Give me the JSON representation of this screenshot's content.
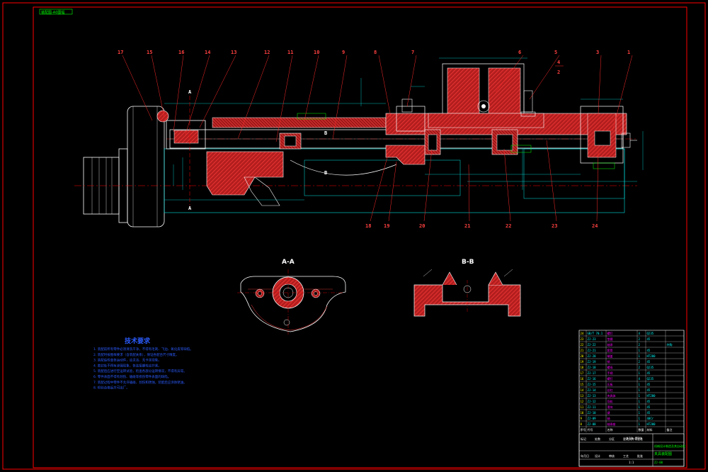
{
  "colors": {
    "background": "#000000",
    "frame": "#ff0000",
    "outline": "#ffffff",
    "hatch": "#ff3b3b",
    "hatch_fill": "#b21e1e",
    "dimension": "#00e5e5",
    "center": "#ff0000",
    "leader": "#ff2a2a",
    "callout": "#ff4040",
    "notes": "#2b5cff",
    "title_green": "#00ff00",
    "title_magenta": "#ff00ff",
    "title_yellow": "#ffff00",
    "title_cyan": "#00ffff"
  },
  "top_left_label": "装配图-A0图幅",
  "section_views": {
    "aa_label": "A-A",
    "bb_label": "B-B",
    "cut_marker_a": "A",
    "cut_marker_b": "B"
  },
  "callouts_top": [
    "17",
    "15",
    "16",
    "14",
    "13",
    "12",
    "11",
    "10",
    "9",
    "8",
    "7",
    "6",
    "5",
    "3",
    "1"
  ],
  "callouts_bottom": [
    "18",
    "19",
    "20",
    "21",
    "22",
    "23",
    "24"
  ],
  "callouts_side": [
    "4",
    "2"
  ],
  "tech_notes": {
    "title": "技术要求",
    "lines": [
      "1. 装配前所有零件必须清洗干净，不得有毛刺、飞边、氧化皮等缺陷。",
      "2. 装配时按图样要求（含装配关系），保证各配合尺寸精度。",
      "3. 装配后检查各运动件，应灵活、无卡滞现象。",
      "4. 密封处不得有渗漏现象，各连接螺栓应拧紧。",
      "5. 装配后应进行空运转试验，检查各部分运转情况，不得有异常。",
      "6. 零件表面不得有划伤、磕碰等损伤零件表面的缺陷。",
      "7. 装配过程中零件不允许磕碰、划伤和锈蚀，装配后应涂防锈油。",
      "8. 检验合格后方可出厂。"
    ]
  },
  "title_block": {
    "part_rows": [
      [
        "24",
        "GB/T 70.1",
        "螺钉",
        "4",
        "Q235",
        ""
      ],
      [
        "23",
        "ZJ-23",
        "垫圈",
        "2",
        "45",
        ""
      ],
      [
        "22",
        "ZJ-22",
        "轴承",
        "2",
        "",
        "外购"
      ],
      [
        "21",
        "ZJ-21",
        "套筒",
        "1",
        "45",
        ""
      ],
      [
        "20",
        "ZJ-20",
        "端盖",
        "1",
        "HT200",
        ""
      ],
      [
        "19",
        "ZJ-19",
        "销",
        "2",
        "45",
        ""
      ],
      [
        "18",
        "ZJ-18",
        "螺母",
        "2",
        "Q235",
        ""
      ],
      [
        "17",
        "ZJ-17",
        "手柄",
        "1",
        "45",
        ""
      ],
      [
        "16",
        "ZJ-16",
        "螺钉",
        "4",
        "Q235",
        ""
      ],
      [
        "15",
        "ZJ-15",
        "压板",
        "1",
        "45",
        ""
      ],
      [
        "14",
        "ZJ-14",
        "丝杠",
        "1",
        "45",
        ""
      ],
      [
        "13",
        "ZJ-13",
        "夹具体",
        "1",
        "HT200",
        ""
      ],
      [
        "12",
        "ZJ-12",
        "导轨",
        "1",
        "45",
        ""
      ],
      [
        "11",
        "ZJ-11",
        "滑块",
        "1",
        "45",
        ""
      ],
      [
        "10",
        "ZJ-10",
        "键",
        "1",
        "45",
        ""
      ],
      [
        "9",
        "ZJ-09",
        "轴",
        "1",
        "40Cr",
        ""
      ],
      [
        "8",
        "ZJ-08",
        "轴承座",
        "1",
        "HT200",
        ""
      ]
    ],
    "header": [
      "序号",
      "代号",
      "名称",
      "数量",
      "材料",
      "备注"
    ],
    "bottom_labels": [
      "标记",
      "处数",
      "分区",
      "更改文件号",
      "签名",
      "年月日",
      "设计",
      "审核",
      "工艺",
      "批准"
    ],
    "drawing_name": "夹具装配图",
    "school": "机械设计制造及其自动化",
    "drawing_no": "ZJ-00",
    "scale": "1:1",
    "sheet": "共1张 第1张"
  }
}
